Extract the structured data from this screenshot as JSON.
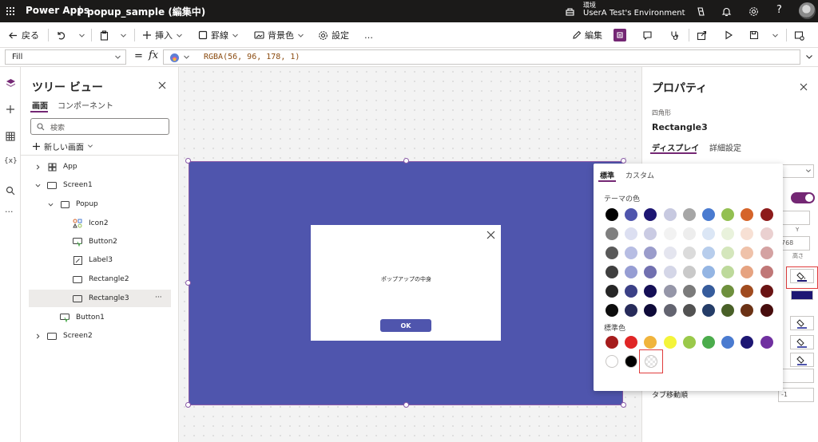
{
  "topbar": {
    "app_name": "Power Apps",
    "separator": "|",
    "doc_title": "popup_sample (編集中)",
    "env_label": "環境",
    "env_name": "UserA Test's Environment",
    "help_glyph": "?"
  },
  "toolbar": {
    "back": "戻る",
    "insert": "挿入",
    "border": "罫線",
    "background": "背景色",
    "settings": "設定",
    "more": "…",
    "edit": "編集"
  },
  "formula": {
    "property": "Fill",
    "equals": "=",
    "fx": "fx",
    "value": "RGBA(56, 96, 178, 1)"
  },
  "tree": {
    "title": "ツリー ビュー",
    "tabs": [
      "画面",
      "コンポーネント"
    ],
    "search_placeholder": "検索",
    "new_screen": "新しい画面",
    "items": [
      {
        "label": "App"
      },
      {
        "label": "Screen1"
      },
      {
        "label": "Popup"
      },
      {
        "label": "Icon2"
      },
      {
        "label": "Button2"
      },
      {
        "label": "Label3"
      },
      {
        "label": "Rectangle2"
      },
      {
        "label": "Rectangle3"
      },
      {
        "label": "Button1"
      },
      {
        "label": "Screen2"
      }
    ],
    "more": "···"
  },
  "canvas": {
    "popup_text": "ポップアップの中身",
    "ok_label": "OK",
    "rect_color": "#4f55ad"
  },
  "props": {
    "title": "プロパティ",
    "type": "四角形",
    "name": "Rectangle3",
    "tabs": [
      "ディスプレイ",
      "詳細設定"
    ],
    "field_y": "Y",
    "field_height": "高さ",
    "value_768": "768",
    "tab_order_label": "タブ移動順",
    "tab_order_value": "-1"
  },
  "picker": {
    "tabs": [
      "標準",
      "カスタム"
    ],
    "theme_label": "テーマの色",
    "standard_label": "標準色",
    "theme_rows": [
      [
        "#000000",
        "#4f55ad",
        "#1d1673",
        "#c7c9e0",
        "#a6a6a6",
        "#4a7bd0",
        "#93c052",
        "#d5642a",
        "#8d1b1b"
      ],
      [
        "#7f7f7f",
        "#dcdff1",
        "#cacbe3",
        "#f2f2f2",
        "#ededed",
        "#dbe6f5",
        "#e9f2dc",
        "#f7e0d4",
        "#ead0d0"
      ],
      [
        "#595959",
        "#b7bde3",
        "#9a9ccb",
        "#e4e5ef",
        "#dbdbdb",
        "#b7cdec",
        "#d4e6bc",
        "#efc2aa",
        "#d4a2a2"
      ],
      [
        "#3f3f3f",
        "#969dd3",
        "#7170b0",
        "#d4d6e7",
        "#c9c9c9",
        "#94b5e3",
        "#bdd99b",
        "#e6a381",
        "#c07777"
      ],
      [
        "#262626",
        "#3b4086",
        "#150f56",
        "#9596a8",
        "#7b7b7b",
        "#365c9c",
        "#6e903d",
        "#a04b1f",
        "#6a1414"
      ],
      [
        "#0d0d0d",
        "#272b5a",
        "#0e0a39",
        "#636470",
        "#525252",
        "#253d68",
        "#496028",
        "#6b3215",
        "#470d0d"
      ]
    ],
    "standard_row1": [
      "#a51c1c",
      "#e02626",
      "#f0b43c",
      "#f4f43a",
      "#9ac94a",
      "#4bac4c",
      "#4a7bd0",
      "#1d1673",
      "#7030a0"
    ],
    "standard_row2": [
      "#ffffff",
      "#000000"
    ]
  },
  "colors": {
    "accent": "#742774",
    "highlight_box": "#e03c3c",
    "ok_button": "#4f55ad"
  }
}
